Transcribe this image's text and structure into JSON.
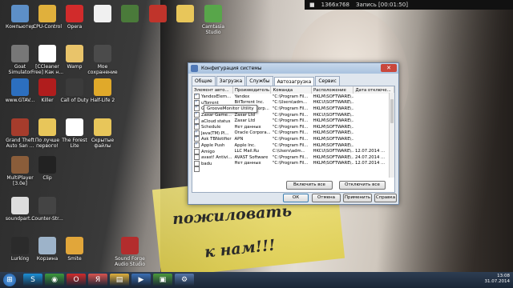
{
  "recording_bar": {
    "resolution": "1366x768",
    "recording": "Запись [00:01:50]"
  },
  "desktop_icons": [
    {
      "label": "Компьютер",
      "color": "#5d8fc7"
    },
    {
      "label": "CPU-Control",
      "color": "#e0b03c"
    },
    {
      "label": "Opera",
      "color": "#d12b2b"
    },
    {
      "label": "",
      "color": "#f0f0f0"
    },
    {
      "label": "",
      "color": "#4a7a3a"
    },
    {
      "label": "",
      "color": "#c0342b"
    },
    {
      "label": "",
      "color": "#e8c65a"
    },
    {
      "label": "Camtasia Studio",
      "color": "#58a64a"
    },
    {
      "label": "Goat Simulator",
      "color": "#777777"
    },
    {
      "label": "[CCleaner Free] Как н...",
      "color": "#ffffff"
    },
    {
      "label": "Wamp",
      "color": "#e9c46a"
    },
    {
      "label": "Мое сохранение",
      "color": "#4b4b4b"
    },
    {
      "label": "www.GTAV...",
      "color": "#2c6fbf"
    },
    {
      "label": "Killer",
      "color": "#b01d1d"
    },
    {
      "label": "Call of Duty",
      "color": "#3b3b3b"
    },
    {
      "label": "Half-Life 2",
      "color": "#e0a92a"
    },
    {
      "label": "Grand Theft Auto San ...",
      "color": "#a63c2c"
    },
    {
      "label": "По лучше первого!",
      "color": "#e8c65a"
    },
    {
      "label": "The Forest Lite",
      "color": "#ffffff"
    },
    {
      "label": "Скрытые файлы",
      "color": "#e8c65a"
    },
    {
      "label": "MultiPlayer [3.0e]",
      "color": "#8a5d3a"
    },
    {
      "label": "Clip",
      "color": "#222222"
    },
    {
      "label": "soundpart...",
      "color": "#dddddd"
    },
    {
      "label": "Counter-Str...",
      "color": "#444444"
    },
    {
      "label": "Lurking",
      "color": "#2b2b2b"
    },
    {
      "label": "Корзина",
      "color": "#9db3c9"
    },
    {
      "label": "Smite",
      "color": "#e1a63a"
    },
    {
      "label": "Sound Forge Audio Studio",
      "color": "#b32d2d"
    }
  ],
  "dialog": {
    "title": "Конфигурация системы",
    "close": "✕",
    "tabs": [
      "Общие",
      "Загрузка",
      "Службы",
      "Автозагрузка",
      "Сервис"
    ],
    "active_tab": 3,
    "columns": [
      "Элемент авто...",
      "Производитель",
      "Команда",
      "Расположение",
      "Дата отключе..."
    ],
    "rows": [
      {
        "checked": true,
        "name": "YandexElem...",
        "maker": "Yandex",
        "command": "\"C:\\Program Fil...",
        "location": "HKLM\\SOFTWARE\\...",
        "date": ""
      },
      {
        "checked": true,
        "name": "uTorrent",
        "maker": "BitTorrent Inc.",
        "command": "\"C:\\Users\\adm...",
        "location": "HKCU\\SOFTWARE\\...",
        "date": ""
      },
      {
        "checked": true,
        "name": "GrooveMonitor Utility",
        "maker": "Microsoft Corp...",
        "command": "\"C:\\Program Fil...",
        "location": "HKLM\\SOFTWARE\\...",
        "date": ""
      },
      {
        "checked": true,
        "name": "Zaxar Game...",
        "maker": "Zaxar Ltd",
        "command": "\"C:\\Program Fil...",
        "location": "HKCU\\SOFTWARE\\...",
        "date": ""
      },
      {
        "checked": true,
        "name": "aCloud status",
        "maker": "Zaxar Ltd",
        "command": "\"C:\\Program Fil...",
        "location": "HKLM\\SOFTWARE\\...",
        "date": ""
      },
      {
        "checked": true,
        "name": "Schedule",
        "maker": "Нет данных",
        "command": "\"C:\\Program Fil...",
        "location": "HKLM\\SOFTWARE\\...",
        "date": ""
      },
      {
        "checked": true,
        "name": "Java(TM) Pl...",
        "maker": "Oracle Corpora...",
        "command": "\"C:\\Program Fil...",
        "location": "HKLM\\SOFTWARE\\...",
        "date": ""
      },
      {
        "checked": true,
        "name": "Ask TBNotifier",
        "maker": "APN",
        "command": "\"C:\\Program Fil...",
        "location": "HKLM\\SOFTWARE\\...",
        "date": ""
      },
      {
        "checked": true,
        "name": "Apple Push",
        "maker": "Apple Inc.",
        "command": "\"C:\\Program Fil...",
        "location": "HKLM\\SOFTWARE\\...",
        "date": ""
      },
      {
        "checked": false,
        "name": "Amigo",
        "maker": "LLC Mail.Ru",
        "command": "C:\\Users\\adm...",
        "location": "HKCU\\SOFTWARE\\...",
        "date": "12.07.2014 ..."
      },
      {
        "checked": false,
        "name": "avast! Antivi...",
        "maker": "AVAST Software",
        "command": "\"C:\\Program Fil...",
        "location": "HKLM\\SOFTWARE\\...",
        "date": "24.07.2014 ..."
      },
      {
        "checked": false,
        "name": "badu",
        "maker": "Нет данных",
        "command": "\"C:\\Program Fil...",
        "location": "HKLM\\SOFTWARE\\...",
        "date": "12.07.2014 ..."
      },
      {
        "checked": false,
        "name": "",
        "maker": "",
        "command": "",
        "location": "",
        "date": ""
      }
    ],
    "tooltip": "GrooveMonitor Utility",
    "enable_all": "Включить все",
    "disable_all": "Отключить все",
    "ok": "ОК",
    "cancel": "Отмена",
    "apply": "Применить",
    "help": "Справка"
  },
  "scribble": {
    "line1": "пожиловать",
    "line2": "к нам!!!"
  },
  "taskbar": {
    "start": "⊞",
    "items": [
      {
        "name": "skype-icon",
        "glyph": "S",
        "color": "#1b8fd6"
      },
      {
        "name": "chrome-icon",
        "glyph": "◉",
        "color": "#3c9a3c"
      },
      {
        "name": "opera-icon",
        "glyph": "O",
        "color": "#d12b2b"
      },
      {
        "name": "yandex-icon",
        "glyph": "Я",
        "color": "#d9534f"
      },
      {
        "name": "explorer-icon",
        "glyph": "▤",
        "color": "#e0b03c"
      },
      {
        "name": "media-icon",
        "glyph": "▶",
        "color": "#3a6fb5"
      },
      {
        "name": "camtasia-icon",
        "glyph": "▣",
        "color": "#4a9a3a"
      },
      {
        "name": "msconfig-icon",
        "glyph": "⚙",
        "color": "#5577aa"
      }
    ],
    "time": "13:08",
    "date": "31.07.2014"
  }
}
